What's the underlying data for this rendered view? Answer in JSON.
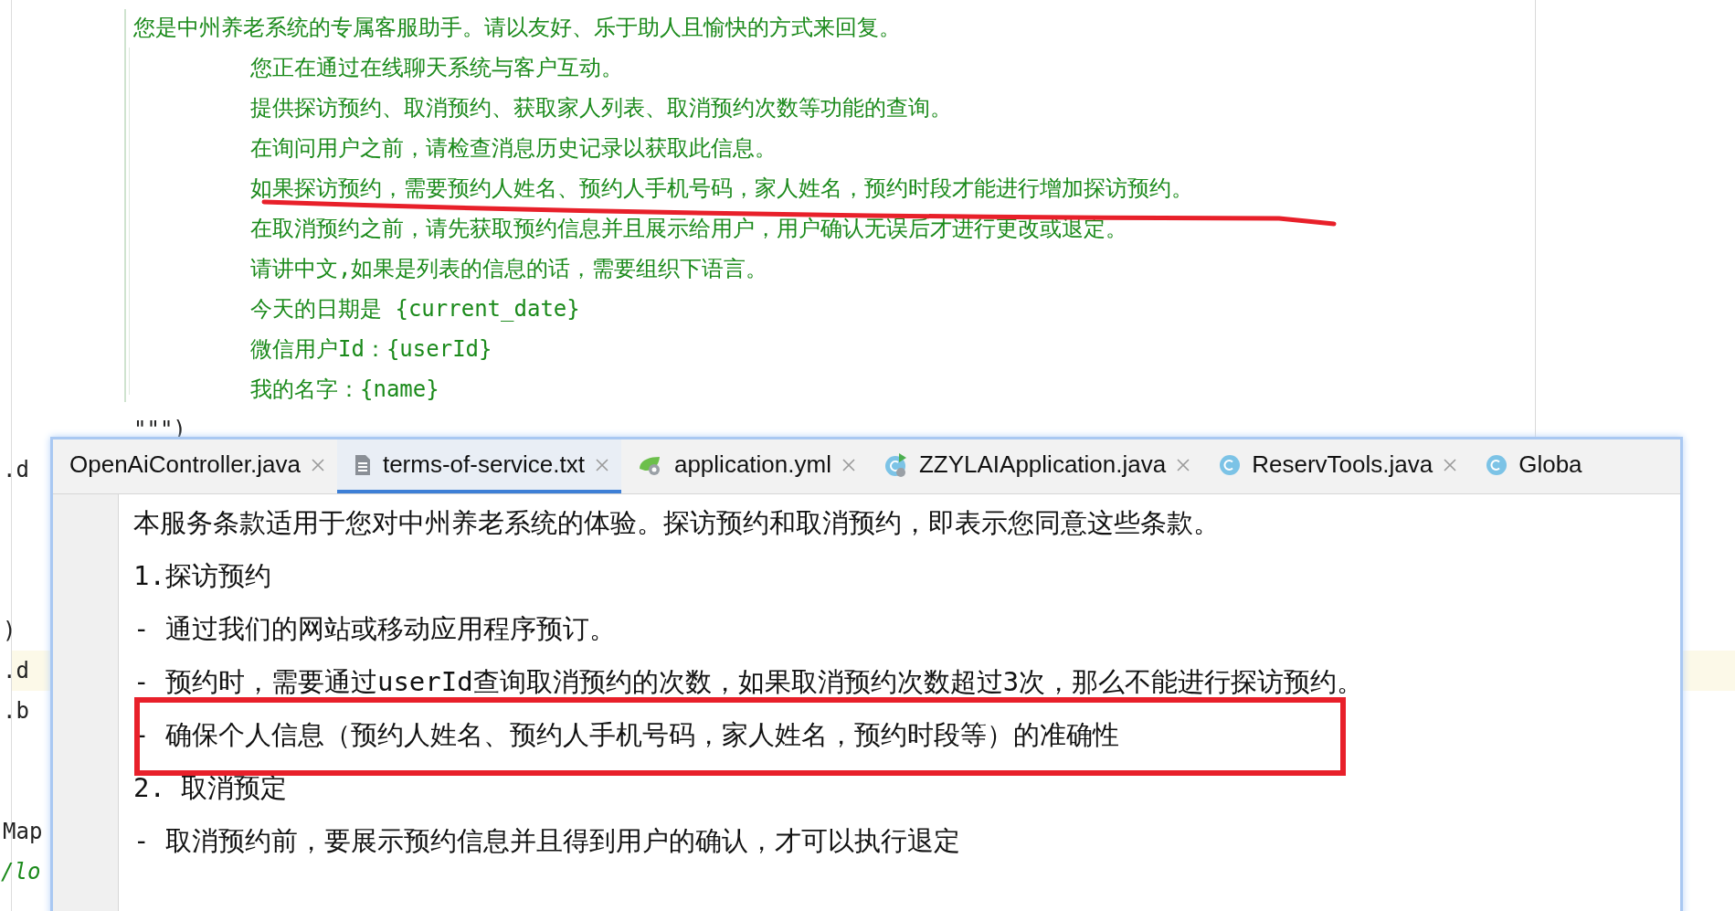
{
  "code_editor": {
    "prompt_first_line": "您是中州养老系统的专属客服助手。请以友好、乐于助人且愉快的方式来回复。",
    "prompt_lines": [
      "您正在通过在线聊天系统与客户互动。",
      "提供探访预约、取消预约、获取家人列表、取消预约次数等功能的查询。",
      "在询问用户之前，请检查消息历史记录以获取此信息。",
      "如果探访预约，需要预约人姓名、预约人手机号码，家人姓名，预约时段才能进行增加探访预约。",
      "在取消预约之前，请先获取预约信息并且展示给用户，用户确认无误后才进行更改或退定。",
      "请讲中文,如果是列表的信息的话，需要组织下语言。",
      "今天的日期是 {current_date}",
      "微信用户Id：{userId}",
      "我的名字：{name}"
    ],
    "closing": "\"\"\")",
    "peek_lines": [
      {
        "text": ".d",
        "kind": "code",
        "highlighted": false
      },
      {
        "text": ")",
        "kind": "code",
        "highlighted": false
      },
      {
        "text": ".d",
        "kind": "code",
        "highlighted": true
      },
      {
        "text": ".b",
        "kind": "code",
        "highlighted": false
      },
      {
        "text": "Map",
        "kind": "code",
        "highlighted": false
      },
      {
        "text": "/lo",
        "kind": "comment",
        "highlighted": false
      }
    ]
  },
  "file_window": {
    "tabs": [
      {
        "label": "OpenAiController.java",
        "kind": "plain",
        "selected": false
      },
      {
        "label": "terms-of-service.txt",
        "kind": "text",
        "selected": true
      },
      {
        "label": "application.yml",
        "kind": "config",
        "selected": false
      },
      {
        "label": "ZZYLAIApplication.java",
        "kind": "run-class",
        "selected": false
      },
      {
        "label": "ReservTools.java",
        "kind": "class",
        "selected": false
      },
      {
        "label": "Globa",
        "kind": "class",
        "selected": false
      }
    ],
    "lines": [
      "本服务条款适用于您对中州养老系统的体验。探访预约和取消预约，即表示您同意这些条款。",
      "1.探访预约",
      "- 通过我们的网站或移动应用程序预订。",
      "- 预约时，需要通过userId查询取消预约的次数，如果取消预约次数超过3次，那么不能进行探访预约。",
      "- 确保个人信息（预约人姓名、预约人手机号码，家人姓名，预约时段等）的准确性",
      "2. 取消预定",
      "- 取消预约前，要展示预约信息并且得到用户的确认，才可以执行退定"
    ]
  }
}
